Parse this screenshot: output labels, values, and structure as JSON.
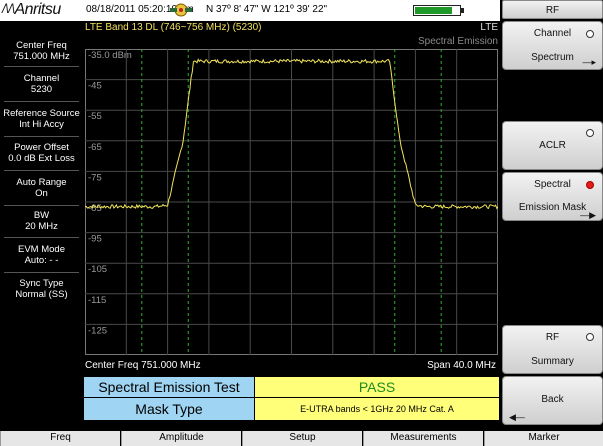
{
  "status": {
    "brand": "Anritsu",
    "datetime": "08/18/2011 05:20:10 pm",
    "gps": "N 37º 8' 47\" W 121º 39' 22\"",
    "battery_level": 0.8
  },
  "settings": [
    {
      "label": "Center Freq",
      "value": "751.000 MHz"
    },
    {
      "label": "Channel",
      "value": "5230"
    },
    {
      "label": "Reference Source",
      "value": "Int Hi Accy"
    },
    {
      "label": "Power Offset",
      "value": "0.0 dB Ext Loss"
    },
    {
      "label": "Auto Range",
      "value": "On"
    },
    {
      "label": "BW",
      "value": "20 MHz"
    },
    {
      "label": "EVM Mode",
      "value": "Auto: - -"
    },
    {
      "label": "Sync Type",
      "value": "Normal (SS)"
    }
  ],
  "plot": {
    "title": "LTE Band 13 DL  (746~756 MHz) (5230)",
    "mode": "LTE",
    "measurement": "Spectral Emission",
    "center_label": "Center Freq  751.000 MHz",
    "span_label": "Span  40.0 MHz"
  },
  "chart_data": {
    "type": "line",
    "x_range_mhz": [
      731,
      771
    ],
    "ylim": [
      -135,
      -35
    ],
    "y_ticks": [
      "-35.0 dBm",
      "-45",
      "-55",
      "-65",
      "-75",
      "-85",
      "-95",
      "-105",
      "-115",
      "-125"
    ],
    "y_tick_values": [
      -35,
      -45,
      -55,
      -65,
      -75,
      -85,
      -95,
      -105,
      -115,
      -125
    ],
    "series": [
      {
        "x": [
          731,
          738,
          739,
          740.5,
          741.5,
          760.5,
          761.5,
          763,
          764,
          771
        ],
        "y": [
          -86.5,
          -86.5,
          -86,
          -65,
          -39,
          -39,
          -65,
          -86,
          -86.5,
          -86.5
        ]
      }
    ],
    "mask_lines_x": [
      736.5,
      741,
      761,
      765.5
    ],
    "grid": true
  },
  "results": {
    "test_label": "Spectral Emission Test",
    "test_result": "PASS",
    "mask_label": "Mask Type",
    "mask_value": "E-UTRA bands < 1GHz 20 MHz Cat. A"
  },
  "softkeys": {
    "header": "RF",
    "channel_spectrum": {
      "line1": "Channel",
      "line2": "Spectrum"
    },
    "aclr": {
      "label": "ACLR"
    },
    "spectral_emission_mask": {
      "line1": "Spectral",
      "line2": "Emission Mask"
    },
    "rf_summary": {
      "line1": "RF",
      "line2": "Summary"
    },
    "back": {
      "label": "Back"
    }
  },
  "menu": [
    "Freq",
    "Amplitude",
    "Setup",
    "Measurements",
    "Marker"
  ],
  "colors": {
    "trace": "#f2e65a",
    "grid": "#4a4a4a",
    "mask_line": "#2fb02f",
    "pass": "#1e8c1e"
  }
}
